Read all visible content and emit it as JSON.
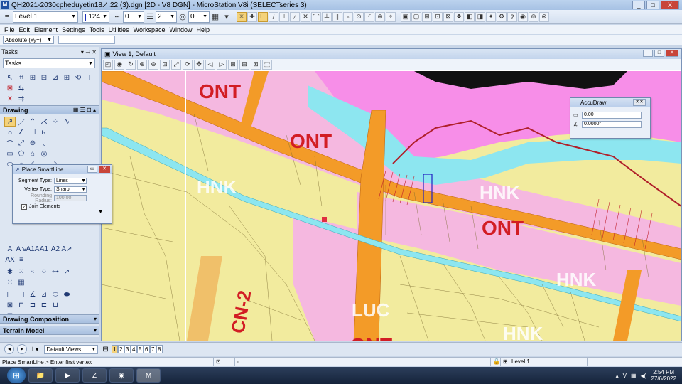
{
  "window": {
    "title": "QH2021-2030cpheduyetin18.4.22 (3).dgn [2D - V8 DGN] - MicroStation V8i (SELECTseries 3)",
    "buttons": [
      "_",
      "□",
      "X"
    ]
  },
  "attributes_toolbar": {
    "level": "Level 1",
    "color": "124",
    "color_hex": "#1a2db5",
    "linestyle": "0",
    "weight": "2",
    "class": "0"
  },
  "menu": [
    "File",
    "Edit",
    "Element",
    "Settings",
    "Tools",
    "Utilities",
    "Workspace",
    "Window",
    "Help"
  ],
  "locks": {
    "mode": "Absolute (xy=)"
  },
  "tasks_panel": {
    "header": "Tasks",
    "selected_task": "Tasks",
    "drawing_section": "Drawing",
    "drawing_composition": "Drawing Composition",
    "terrain_model": "Terrain Model"
  },
  "view": {
    "title": "View 1, Default",
    "buttons": [
      "_",
      "□",
      "X"
    ]
  },
  "map_labels": [
    {
      "text": "ONT",
      "color": "#d21d24"
    },
    {
      "text": "ONT",
      "color": "#d21d24"
    },
    {
      "text": "HNK",
      "color": "#ffffff"
    },
    {
      "text": "HNK",
      "color": "#ffffff"
    },
    {
      "text": "ONT",
      "color": "#d21d24"
    },
    {
      "text": "HNK",
      "color": "#ffffff"
    },
    {
      "text": "HNK",
      "color": "#ffffff"
    },
    {
      "text": "LUC",
      "color": "#ffffff"
    },
    {
      "text": "ONT",
      "color": "#d21d24"
    },
    {
      "text": "CN-2",
      "color": "#d21d24"
    }
  ],
  "smartline": {
    "title": "Place SmartLine",
    "segment_type_label": "Segment Type:",
    "segment_type": "Lines",
    "vertex_type_label": "Vertex Type:",
    "vertex_type": "Sharp",
    "rounding_radius_label": "Rounding Radius:",
    "rounding_radius": "100.00",
    "join_elements": "Join Elements"
  },
  "accudraw": {
    "title": "AccuDraw",
    "distance": "0.00",
    "angle": "0.0000°"
  },
  "view_nav": {
    "views_combo": "Default Views",
    "view_numbers": [
      "1",
      "2",
      "3",
      "4",
      "5",
      "6",
      "7",
      "8"
    ]
  },
  "status": {
    "prompt": "Place SmartLine > Enter first vertex",
    "level": "Level 1"
  },
  "taskbar": {
    "time": "2:54 PM",
    "date": "27/6/2022",
    "tray_v": "V"
  }
}
